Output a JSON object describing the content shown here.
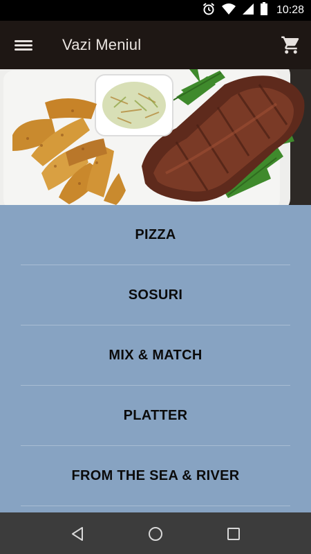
{
  "status_bar": {
    "time": "10:28",
    "icons": [
      "alarm-icon",
      "wifi-icon",
      "signal-icon",
      "battery-icon"
    ]
  },
  "app_bar": {
    "menu_icon": "hamburger-menu-icon",
    "title": "Vazi Meniul",
    "cart_icon": "shopping-cart-icon"
  },
  "hero": {
    "image": "food-photo"
  },
  "menu": {
    "items": [
      {
        "label": "PIZZA"
      },
      {
        "label": "SOSURI"
      },
      {
        "label": "MIX & MATCH"
      },
      {
        "label": "PLATTER"
      },
      {
        "label": "FROM THE SEA & RIVER"
      }
    ]
  },
  "nav_bar": {
    "icons": [
      "back-icon",
      "home-icon",
      "recents-icon"
    ]
  },
  "colors": {
    "app_bar": "#1e1714",
    "list_background": "#87a3c2",
    "nav_bar": "#3c3c3c",
    "status_bar": "#000000"
  }
}
